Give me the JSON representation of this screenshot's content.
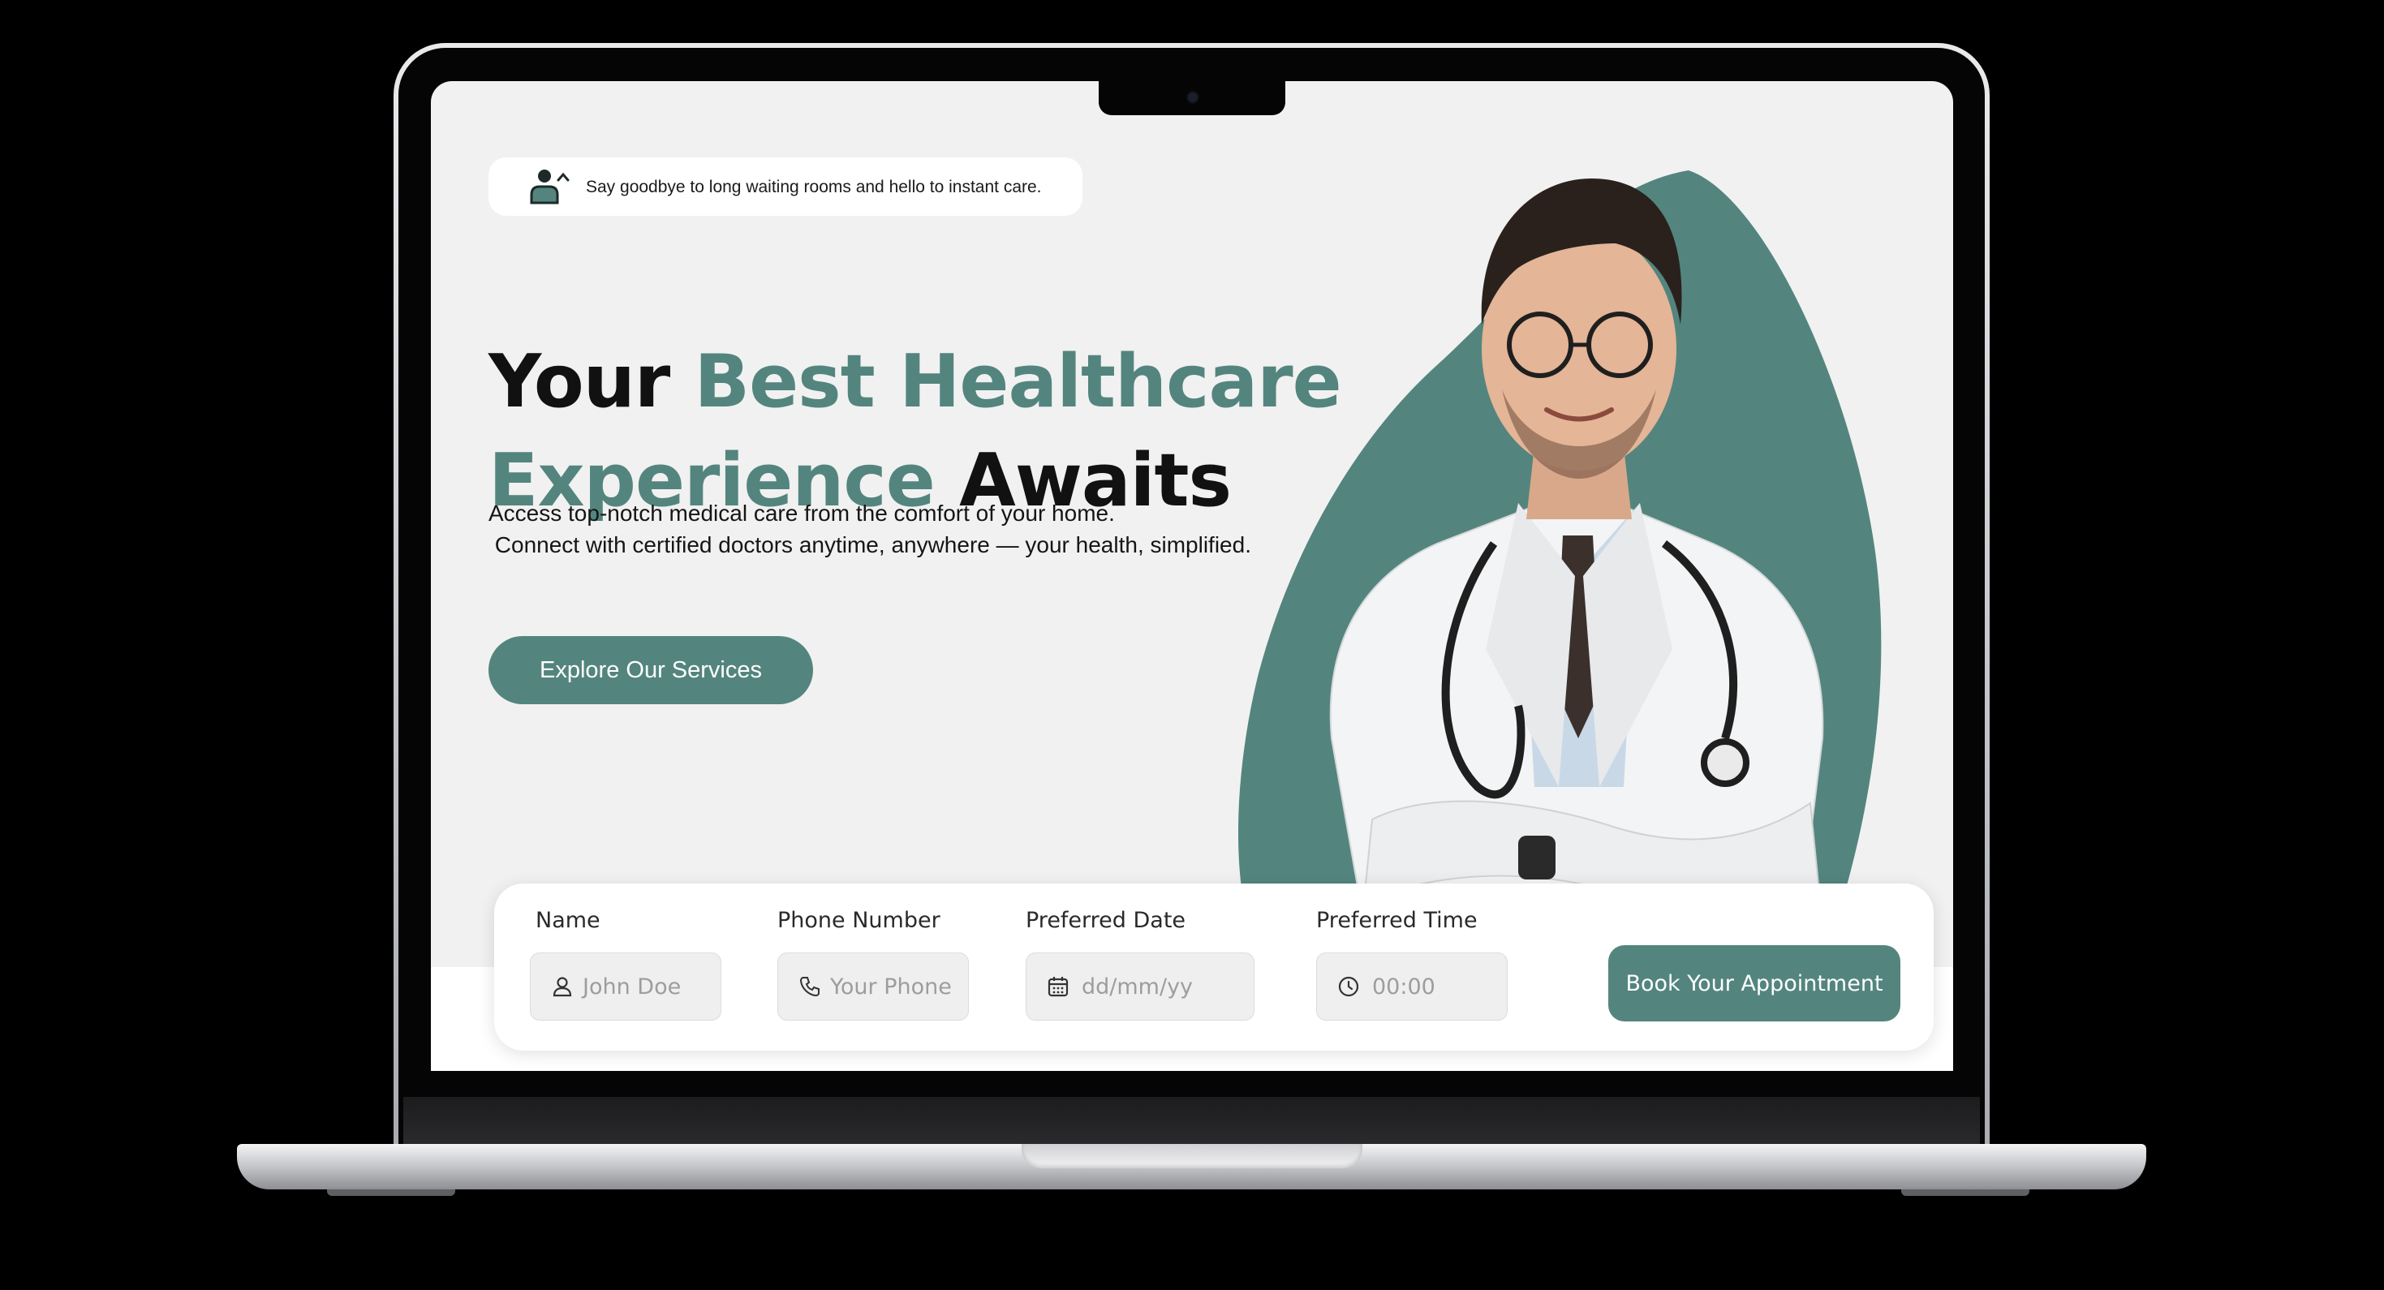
{
  "tagline": {
    "icon": "doctor-person-icon",
    "text": "Say goodbye to long waiting rooms and hello to instant care."
  },
  "headline": {
    "part1": "Your ",
    "part1_accent": "Best Healthcare",
    "part2_accent": "Experience",
    "part2": " Awaits"
  },
  "subtext": {
    "line1": "Access top-notch medical care from the comfort of your home.",
    "line2": " Connect with certified doctors anytime, anywhere — your health, simplified."
  },
  "cta": {
    "label": "Explore Our Services"
  },
  "booking": {
    "name_label": "Name",
    "name_placeholder": "John Doe",
    "phone_label": "Phone Number",
    "phone_placeholder": "Your Phone",
    "date_label": "Preferred Date",
    "date_placeholder": "dd/mm/yy",
    "time_label": "Preferred Time",
    "time_placeholder": "00:00",
    "submit_label": "Book Your Appointment"
  },
  "colors": {
    "accent": "#53857e",
    "page_background": "#f1f1f1",
    "card_background": "#ffffff"
  }
}
